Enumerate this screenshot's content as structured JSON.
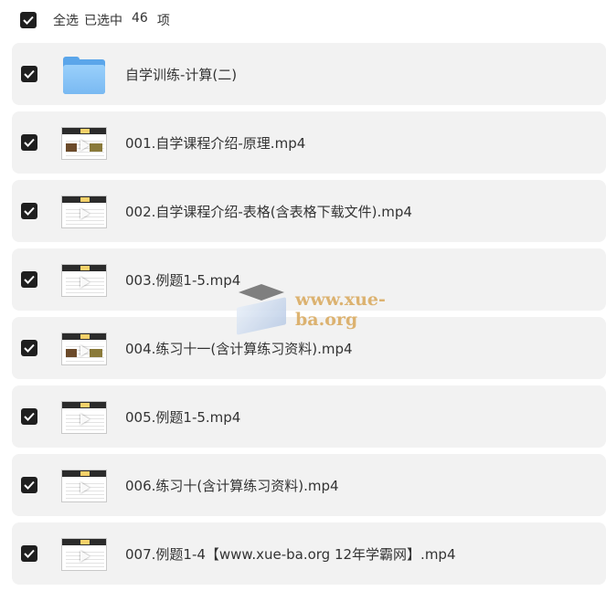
{
  "select_all": {
    "label": "全选",
    "selected_prefix": "已选中",
    "selected_count": "46",
    "selected_suffix": "项",
    "checked": true
  },
  "items": [
    {
      "type": "folder",
      "name": "自学训练-计算(二)",
      "checked": true
    },
    {
      "type": "video",
      "name": "001.自学课程介绍-原理.mp4",
      "checked": true
    },
    {
      "type": "video",
      "name": "002.自学课程介绍-表格(含表格下载文件).mp4",
      "checked": true
    },
    {
      "type": "video",
      "name": "003.例题1-5.mp4",
      "checked": true
    },
    {
      "type": "video",
      "name": "004.练习十一(含计算练习资料).mp4",
      "checked": true
    },
    {
      "type": "video",
      "name": "005.例题1-5.mp4",
      "checked": true
    },
    {
      "type": "video",
      "name": "006.练习十(含计算练习资料).mp4",
      "checked": true
    },
    {
      "type": "video",
      "name": "007.例题1-4【www.xue-ba.org 12年学霸网】.mp4",
      "checked": true
    }
  ],
  "watermark": {
    "text": "www.xue-ba.org"
  },
  "colors": {
    "row_bg": "#f2f2f2",
    "checkbox": "#1f1f1f",
    "folder": "#79b9f2",
    "watermark": "#d9a85a"
  }
}
